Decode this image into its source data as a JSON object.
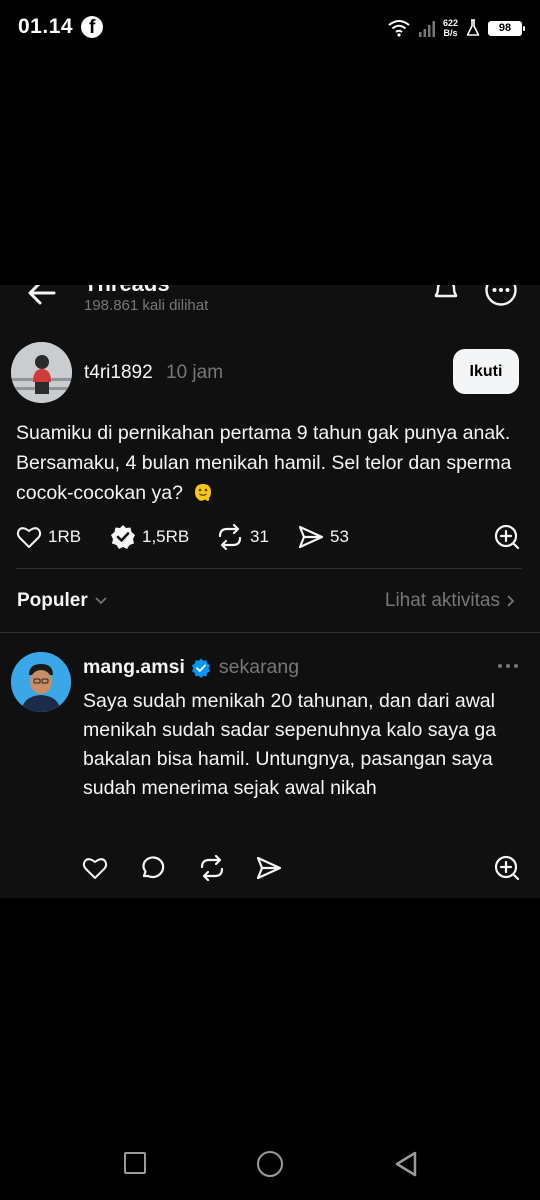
{
  "status_bar": {
    "time": "01.14",
    "facebook_glyph": "f",
    "net_speed_value": "622",
    "net_speed_unit": "B/s",
    "battery": "98"
  },
  "header": {
    "title": "Threads",
    "views": "198.861 kali dilihat"
  },
  "post": {
    "username": "t4ri1892",
    "time": "10 jam",
    "follow_label": "Ikuti",
    "text": "Suamiku di pernikahan pertama 9 tahun gak punya anak. Bersamaku, 4 bulan menikah hamil. Sel telor dan sperma cocok-cocokan ya?",
    "emoji": "melting-face-emoji",
    "likes": "1RB",
    "reposts_verified": "1,5RB",
    "reposts": "31",
    "shares": "53"
  },
  "sort": {
    "label": "Populer",
    "activity_link": "Lihat aktivitas"
  },
  "reply": {
    "username": "mang.amsi",
    "time": "sekarang",
    "text": "Saya sudah menikah 20 tahunan, dan dari awal menikah sudah sadar sepenuhnya kalo saya ga bakalan bisa hamil. Untungnya, pasangan saya sudah menerima sejak awal nikah"
  },
  "colors": {
    "background": "#000000",
    "panel": "#101010",
    "text": "#f3f5f7",
    "muted": "#777777",
    "verified": "#0095f6"
  }
}
